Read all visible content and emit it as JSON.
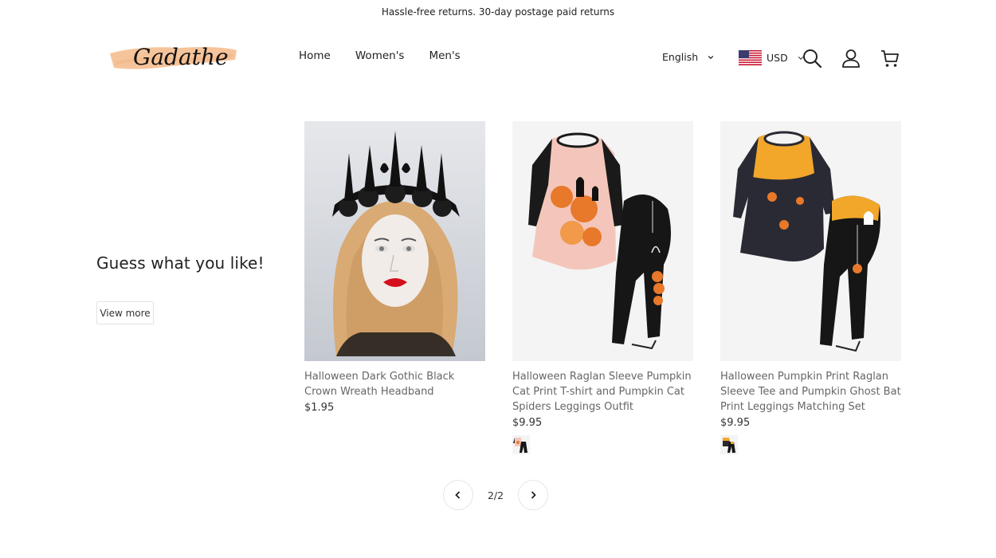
{
  "announcement": "Hassle-free returns. 30-day postage paid returns",
  "brand": {
    "name": "Gadathe",
    "accent": "#f6c49a"
  },
  "nav": [
    {
      "label": "Home"
    },
    {
      "label": "Women's"
    },
    {
      "label": "Men's"
    }
  ],
  "language": {
    "selected": "English"
  },
  "currency": {
    "selected": "USD"
  },
  "icons": {
    "search": "search-icon",
    "account": "user-icon",
    "cart": "cart-icon"
  },
  "promo": {
    "heading": "Guess what you like!",
    "button": "View more"
  },
  "products": [
    {
      "title": "Halloween Dark Gothic Black Crown Wreath Headband",
      "price": "$1.95",
      "has_swatch": false
    },
    {
      "title": "Halloween Raglan Sleeve Pumpkin Cat Print T-shirt and Pumpkin Cat Spiders Leggings Outfit",
      "price": "$9.95",
      "has_swatch": true
    },
    {
      "title": "Halloween Pumpkin Print Raglan Sleeve Tee and Pumpkin Ghost Bat Print Leggings Matching Set",
      "price": "$9.95",
      "has_swatch": true
    }
  ],
  "pagination": {
    "current": "2/2"
  }
}
